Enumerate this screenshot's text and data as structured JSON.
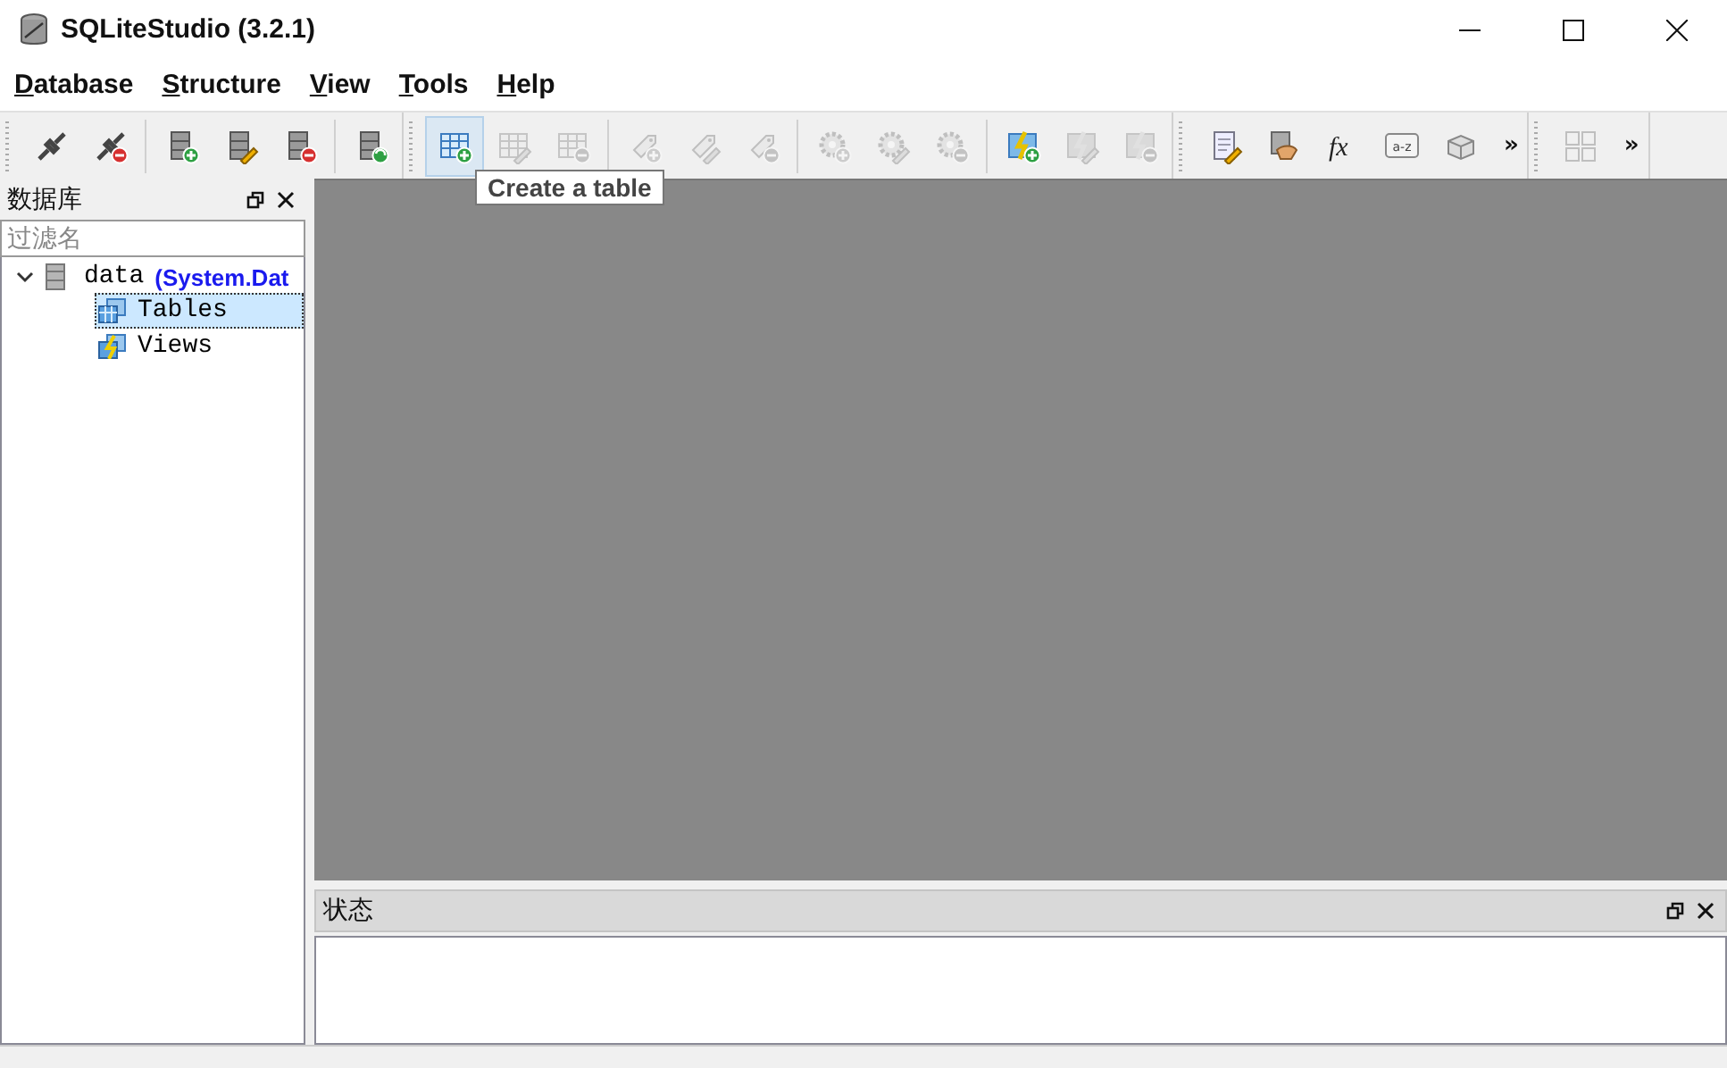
{
  "window": {
    "title": "SQLiteStudio (3.2.1)"
  },
  "menu": [
    "Database",
    "Structure",
    "View",
    "Tools",
    "Help"
  ],
  "toolbars": [
    {
      "groups": [
        [
          {
            "kind": "plug",
            "disabled": false,
            "hovered": false
          },
          {
            "kind": "unplug",
            "disabled": false,
            "hovered": false
          }
        ],
        [
          {
            "kind": "db-add",
            "disabled": false,
            "hovered": false
          },
          {
            "kind": "db-edit",
            "disabled": false,
            "hovered": false
          },
          {
            "kind": "db-remove",
            "disabled": false,
            "hovered": false
          }
        ],
        [
          {
            "kind": "db-refresh",
            "disabled": false,
            "hovered": false
          }
        ]
      ]
    },
    {
      "groups": [
        [
          {
            "kind": "table-add",
            "disabled": false,
            "hovered": true
          },
          {
            "kind": "table-edit",
            "disabled": true,
            "hovered": false
          },
          {
            "kind": "table-remove",
            "disabled": true,
            "hovered": false
          }
        ],
        [
          {
            "kind": "tag-add",
            "disabled": true,
            "hovered": false
          },
          {
            "kind": "tag-edit",
            "disabled": true,
            "hovered": false
          },
          {
            "kind": "tag-remove",
            "disabled": true,
            "hovered": false
          }
        ],
        [
          {
            "kind": "gear-add",
            "disabled": true,
            "hovered": false
          },
          {
            "kind": "gear-edit",
            "disabled": true,
            "hovered": false
          },
          {
            "kind": "gear-remove",
            "disabled": true,
            "hovered": false
          }
        ],
        [
          {
            "kind": "view-add",
            "disabled": false,
            "hovered": false
          },
          {
            "kind": "view-edit",
            "disabled": true,
            "hovered": false
          },
          {
            "kind": "view-remove",
            "disabled": true,
            "hovered": false
          }
        ]
      ]
    },
    {
      "groups": [
        [
          {
            "kind": "doc-edit",
            "disabled": false,
            "hovered": false
          },
          {
            "kind": "hand",
            "disabled": false,
            "hovered": false
          },
          {
            "kind": "text",
            "label": "fx",
            "disabled": false,
            "hovered": false
          },
          {
            "kind": "az",
            "label": "a-z",
            "disabled": false,
            "hovered": false
          },
          {
            "kind": "block",
            "disabled": false,
            "hovered": false
          }
        ]
      ],
      "overflow": "»"
    },
    {
      "groups": [
        [
          {
            "kind": "grid",
            "disabled": true,
            "hovered": false
          }
        ]
      ],
      "overflow": "»"
    }
  ],
  "tooltip": "Create a table",
  "database_panel": {
    "title": "数据库",
    "filter": {
      "placeholder": "过滤名"
    },
    "tree": [
      {
        "label": "data",
        "detail": "(System.Dat",
        "expanded": true,
        "kind": "db",
        "children": [
          {
            "label": "Tables",
            "kind": "tables",
            "selected": true
          },
          {
            "label": "Views",
            "kind": "views",
            "selected": false
          }
        ]
      }
    ]
  },
  "status_panel": {
    "title": "状态"
  }
}
